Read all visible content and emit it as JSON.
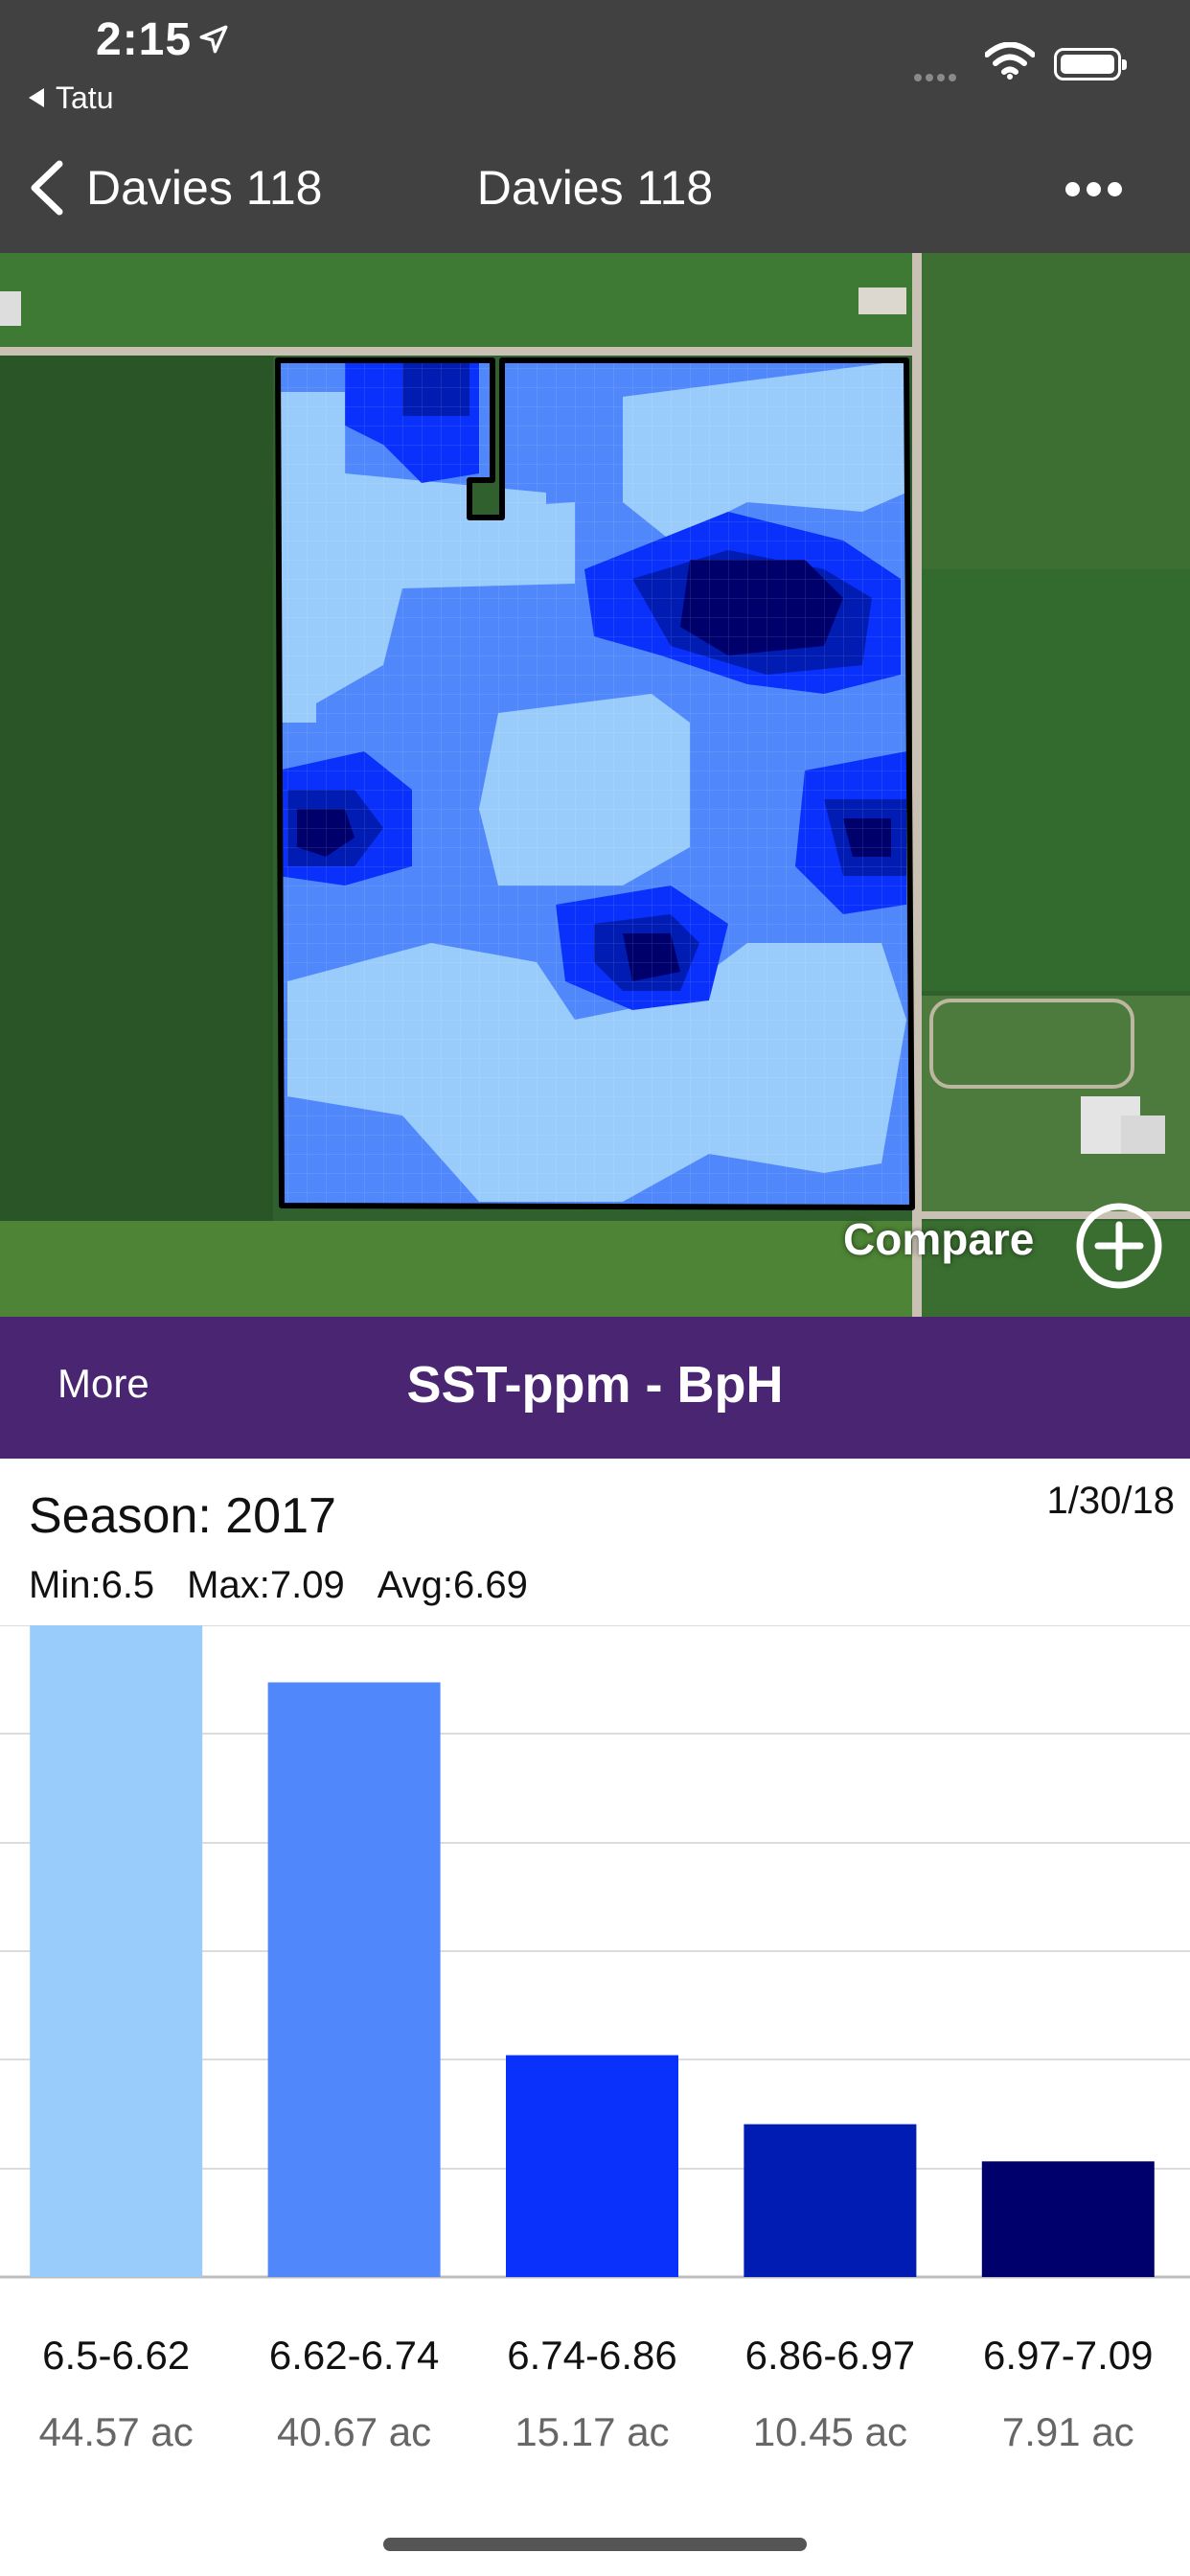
{
  "status_bar": {
    "time": "2:15",
    "back_app": "Tatu"
  },
  "nav": {
    "back_label": "Davies 118",
    "title": "Davies 118"
  },
  "map": {
    "compare_label": "Compare"
  },
  "layer_bar": {
    "more_label": "More",
    "title": "SST-ppm - BpH"
  },
  "stats": {
    "season": "Season: 2017",
    "date": "1/30/18",
    "min": "Min:6.5",
    "max": "Max:7.09",
    "avg": "Avg:6.69"
  },
  "chart_data": {
    "type": "bar",
    "categories": [
      "6.5-6.62",
      "6.62-6.74",
      "6.74-6.86",
      "6.86-6.97",
      "6.97-7.09"
    ],
    "values": [
      44.57,
      40.67,
      15.17,
      10.45,
      7.91
    ],
    "value_labels": [
      "44.57 ac",
      "40.67 ac",
      "15.17 ac",
      "10.45 ac",
      "7.91 ac"
    ],
    "colors": [
      "#99ccfb",
      "#5088fc",
      "#0a30fb",
      "#001cb3",
      "#00006d"
    ],
    "ylim": [
      0,
      44.57
    ],
    "grid": true
  },
  "icons": {
    "location": "location-arrow-icon",
    "signal": "cellular-signal-icon",
    "wifi": "wifi-icon",
    "battery": "battery-icon",
    "back": "chevron-left-icon",
    "more": "more-dots-icon",
    "compare": "plus-circle-icon"
  }
}
